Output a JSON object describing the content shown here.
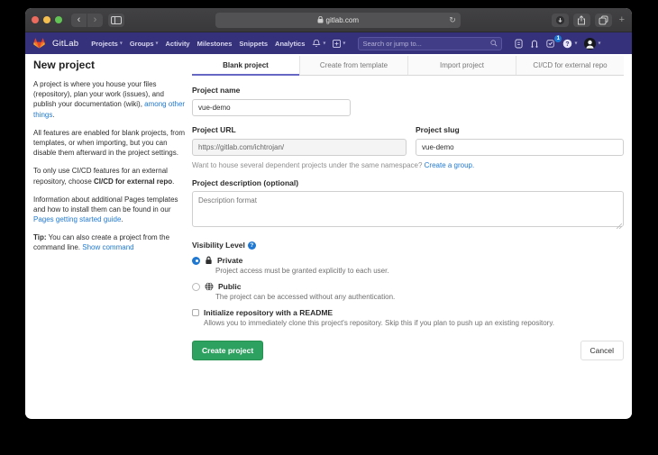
{
  "browser": {
    "address": "gitlab.com",
    "new_tab_glyph": "+",
    "back_glyph": "‹",
    "forward_glyph": "›",
    "reload_glyph": "↻"
  },
  "navbar": {
    "brand": "GitLab",
    "links": [
      {
        "label": "Projects",
        "caret": true
      },
      {
        "label": "Groups",
        "caret": true
      },
      {
        "label": "Activity",
        "caret": false
      },
      {
        "label": "Milestones",
        "caret": false
      },
      {
        "label": "Snippets",
        "caret": false
      },
      {
        "label": "Analytics",
        "caret": false
      }
    ],
    "search_placeholder": "Search or jump to...",
    "todo_count": "1",
    "icons": [
      "bell-icon",
      "new-menu-icon",
      "issues-icon",
      "merge-requests-icon",
      "todos-icon",
      "help-icon",
      "user-avatar"
    ]
  },
  "sidebar": {
    "heading": "New project",
    "p1_text": "A project is where you house your files (repository), plan your work (issues), and publish your documentation (wiki), ",
    "p1_link": "among other things",
    "p1_end": ".",
    "p2": "All features are enabled for blank projects, from templates, or when importing, but you can disable them afterward in the project settings.",
    "p3_text": "To only use CI/CD features for an external repository, choose ",
    "p3_bold": "CI/CD for external repo",
    "p3_end": ".",
    "p4_text": "Information about additional Pages templates and how to install them can be found in our ",
    "p4_link": "Pages getting started guide",
    "p4_end": ".",
    "p5_bold": "Tip:",
    "p5_text": " You can also create a project from the command line. ",
    "p5_link": "Show command"
  },
  "tabs": {
    "active_index": 0,
    "items": [
      {
        "label": "Blank project"
      },
      {
        "label": "Create from template"
      },
      {
        "label": "Import project"
      },
      {
        "label": "CI/CD for external repo"
      }
    ]
  },
  "form": {
    "name_label": "Project name",
    "name_value": "vue-demo",
    "url_label": "Project URL",
    "url_value": "https://gitlab.com/ichtrojan/",
    "slug_label": "Project slug",
    "slug_value": "vue-demo",
    "namespace_hint": "Want to house several dependent projects under the same namespace? ",
    "namespace_link": "Create a group.",
    "desc_label": "Project description (optional)",
    "desc_placeholder": "Description format",
    "visibility_label": "Visibility Level",
    "visibility_options": [
      {
        "name": "Private",
        "desc": "Project access must be granted explicitly to each user.",
        "selected": true,
        "icon": "lock-icon"
      },
      {
        "name": "Public",
        "desc": "The project can be accessed without any authentication.",
        "selected": false,
        "icon": "globe-icon"
      }
    ],
    "readme_label": "Initialize repository with a README",
    "readme_desc": "Allows you to immediately clone this project's repository. Skip this if you plan to push up an existing repository.",
    "readme_checked": false,
    "submit_label": "Create project",
    "cancel_label": "Cancel"
  },
  "colors": {
    "navbar_bg": "#35317b",
    "link_blue": "#1f78d1",
    "button_green": "#2da160",
    "active_tab_underline": "#6666c4",
    "badge_blue": "#1f78d1"
  }
}
